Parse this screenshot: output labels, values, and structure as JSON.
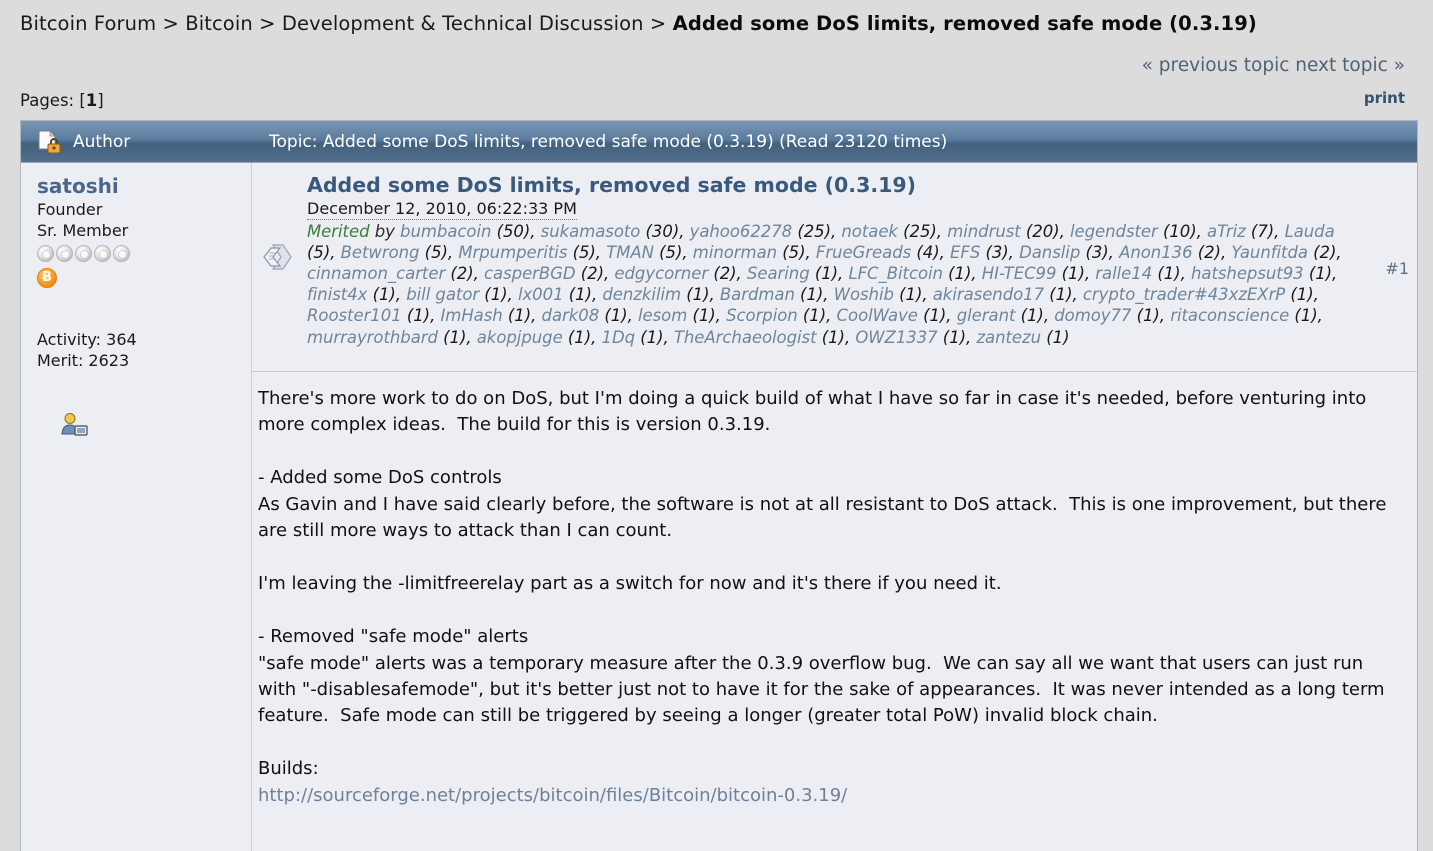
{
  "breadcrumb": {
    "items": [
      "Bitcoin Forum",
      "Bitcoin",
      "Development & Technical Discussion"
    ],
    "separator": " > ",
    "current": "Added some DoS limits, removed safe mode (0.3.19)"
  },
  "topic_nav": {
    "previous": "« previous topic",
    "next": "next topic »",
    "print": "print"
  },
  "pages": {
    "label": "Pages: [",
    "current": "1",
    "close": "]"
  },
  "topic_header": {
    "author_column": "Author",
    "topic_column": "Topic: Added some DoS limits, removed safe mode (0.3.19)  (Read 23120 times)",
    "lock_icon": "locked-topic-icon"
  },
  "poster": {
    "name": "satoshi",
    "title": "Founder",
    "rank": "Sr. Member",
    "star_count": 5,
    "coin_symbol": "Ƀ",
    "activity": "Activity: 364",
    "merit": "Merit: 2623",
    "profile_icon": "view-profile-icon"
  },
  "post": {
    "subject": "Added some DoS limits, removed safe mode (0.3.19)",
    "date": "December 12, 2010, 06:22:33 PM",
    "number": "#1",
    "post_icon": "post-message-icon",
    "merited": {
      "label": "Merited",
      "by": "by",
      "entries": [
        {
          "name": "bumbacoin",
          "count": "(50)"
        },
        {
          "name": "sukamasoto",
          "count": "(30)"
        },
        {
          "name": "yahoo62278",
          "count": "(25)"
        },
        {
          "name": "notaek",
          "count": "(25)"
        },
        {
          "name": "mindrust",
          "count": "(20)"
        },
        {
          "name": "legendster",
          "count": "(10)"
        },
        {
          "name": "aTriz",
          "count": "(7)"
        },
        {
          "name": "Lauda",
          "count": "(5)"
        },
        {
          "name": "Betwrong",
          "count": "(5)"
        },
        {
          "name": "Mrpumperitis",
          "count": "(5)"
        },
        {
          "name": "TMAN",
          "count": "(5)"
        },
        {
          "name": "minorman",
          "count": "(5)"
        },
        {
          "name": "FrueGreads",
          "count": "(4)"
        },
        {
          "name": "EFS",
          "count": "(3)"
        },
        {
          "name": "Danslip",
          "count": "(3)"
        },
        {
          "name": "Anon136",
          "count": "(2)"
        },
        {
          "name": "Yaunfitda",
          "count": "(2)"
        },
        {
          "name": "cinnamon_carter",
          "count": "(2)"
        },
        {
          "name": "casperBGD",
          "count": "(2)"
        },
        {
          "name": "edgycorner",
          "count": "(2)"
        },
        {
          "name": "Searing",
          "count": "(1)"
        },
        {
          "name": "LFC_Bitcoin",
          "count": "(1)"
        },
        {
          "name": "HI-TEC99",
          "count": "(1)"
        },
        {
          "name": "ralle14",
          "count": "(1)"
        },
        {
          "name": "hatshepsut93",
          "count": "(1)"
        },
        {
          "name": "finist4x",
          "count": "(1)"
        },
        {
          "name": "bill gator",
          "count": "(1)"
        },
        {
          "name": "lx001",
          "count": "(1)"
        },
        {
          "name": "denzkilim",
          "count": "(1)"
        },
        {
          "name": "Bardman",
          "count": "(1)"
        },
        {
          "name": "Woshib",
          "count": "(1)"
        },
        {
          "name": "akirasendo17",
          "count": "(1)"
        },
        {
          "name": "crypto_trader#43xzEXrP",
          "count": "(1)"
        },
        {
          "name": "Rooster101",
          "count": "(1)"
        },
        {
          "name": "ImHash",
          "count": "(1)"
        },
        {
          "name": "dark08",
          "count": "(1)"
        },
        {
          "name": "lesom",
          "count": "(1)"
        },
        {
          "name": "Scorpion",
          "count": "(1)"
        },
        {
          "name": "CoolWave",
          "count": "(1)"
        },
        {
          "name": "glerant",
          "count": "(1)"
        },
        {
          "name": "domoy77",
          "count": "(1)"
        },
        {
          "name": "ritaconscience",
          "count": "(1)"
        },
        {
          "name": "murrayrothbard",
          "count": "(1)"
        },
        {
          "name": "akopjpuge",
          "count": "(1)"
        },
        {
          "name": "1Dq",
          "count": "(1)"
        },
        {
          "name": "TheArchaeologist",
          "count": "(1)"
        },
        {
          "name": "OWZ1337",
          "count": "(1)"
        },
        {
          "name": "zantezu",
          "count": "(1)"
        }
      ]
    },
    "body_text": "There's more work to do on DoS, but I'm doing a quick build of what I have so far in case it's needed, before venturing into more complex ideas.  The build for this is version 0.3.19.\n\n- Added some DoS controls\nAs Gavin and I have said clearly before, the software is not at all resistant to DoS attack.  This is one improvement, but there are still more ways to attack than I can count.\n\nI'm leaving the -limitfreerelay part as a switch for now and it's there if you need it.\n\n- Removed \"safe mode\" alerts\n\"safe mode\" alerts was a temporary measure after the 0.3.9 overflow bug.  We can say all we want that users can just run with \"-disablesafemode\", but it's better just not to have it for the sake of appearances.  It was never intended as a long term feature.  Safe mode can still be triggered by seeing a longer (greater total PoW) invalid block chain.\n\nBuilds:\n",
    "build_link": "http://sourceforge.net/projects/bitcoin/files/Bitcoin/bitcoin-0.3.19/"
  },
  "colors": {
    "page_background": "#dcdcdc",
    "panel_background": "#eceef3",
    "header_bar": "#5b7c9d",
    "link": "#6f8298",
    "poster_name": "#49678a",
    "subject": "#3a5a7d",
    "merit_word": "#3b7d3b",
    "coin": "#f59a21"
  }
}
